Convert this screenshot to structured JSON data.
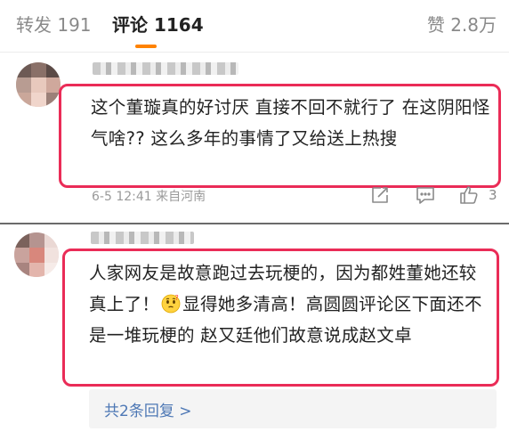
{
  "tabs": {
    "repost_label": "转发",
    "repost_count": "191",
    "comments_label": "评论",
    "comments_count": "1164",
    "likes_label": "赞",
    "likes_count": "2.8万"
  },
  "comments": [
    {
      "text": "这个董璇真的好讨厌 直接不回不就行了 在这阴阳怪气啥?? 这么多年的事情了又给送上热搜",
      "meta": "6-5 12:41 来自河南",
      "like_count": "3"
    },
    {
      "text_part1": "人家网友是故意跑过去玩梗的，因为都姓董她还较真上了！",
      "text_part2": "显得她多清高！高圆圆评论区下面还不是一堆玩梗的 赵又廷他们故意说成赵文卓",
      "emoji": "thinking-face-emoji",
      "replies_label": "共2条回复 >"
    }
  ],
  "colors": {
    "accent": "#ff8200",
    "highlight": "#ea2c57",
    "link": "#4e78b5"
  },
  "icons": [
    "share-icon",
    "reply-icon",
    "like-icon"
  ]
}
